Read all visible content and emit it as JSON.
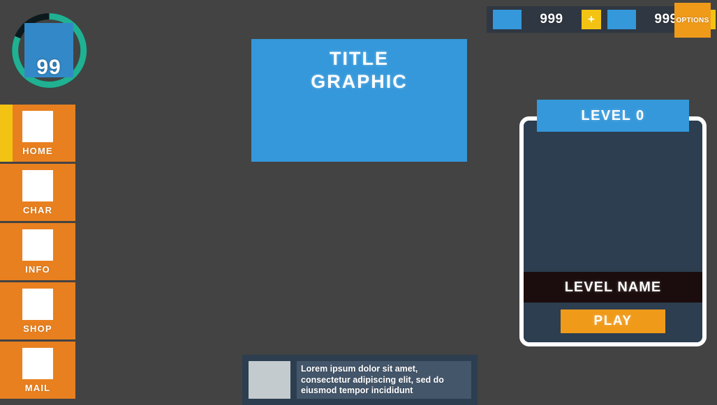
{
  "colors": {
    "background": "#434343",
    "accent_blue": "#3498db",
    "accent_orange": "#e8801f",
    "accent_yellow": "#f2c313",
    "panel_navy": "#2c3e50",
    "ring_teal": "#1fb191",
    "ring_track": "#0d1a1d",
    "play_orange": "#f09a1a",
    "level_name_band": "#1b0d0d"
  },
  "avatar": {
    "level_value": "99",
    "icon": "avatar-portrait-icon",
    "ring_icon": "progress-ring-icon",
    "ring_progress_percent": 80
  },
  "sidebar": {
    "items": [
      {
        "label": "HOME",
        "icon": "home-icon",
        "active": true
      },
      {
        "label": "CHAR",
        "icon": "character-icon",
        "active": false
      },
      {
        "label": "INFO",
        "icon": "info-icon",
        "active": false
      },
      {
        "label": "SHOP",
        "icon": "shop-icon",
        "active": false
      },
      {
        "label": "MAIL",
        "icon": "mail-icon",
        "active": false
      }
    ]
  },
  "title_graphic": {
    "line1": "TITLE",
    "line2": "GRAPHIC"
  },
  "currency_bar": {
    "groups": [
      {
        "icon": "currency-soft-icon",
        "amount": "999",
        "plus_label": "+"
      },
      {
        "icon": "currency-hard-icon",
        "amount": "999",
        "plus_label": "+"
      }
    ],
    "options_label": "OPTIONS",
    "options_icon": "options-icon"
  },
  "level_panel": {
    "header_label": "LEVEL 0",
    "preview_icon": "level-preview-icon",
    "level_name": "LEVEL NAME",
    "play_label": "PLAY"
  },
  "notification": {
    "thumbnail_icon": "notification-thumbnail-icon",
    "text": "Lorem ipsum dolor sit amet, consectetur adipiscing elit, sed do eiusmod tempor incididunt"
  }
}
